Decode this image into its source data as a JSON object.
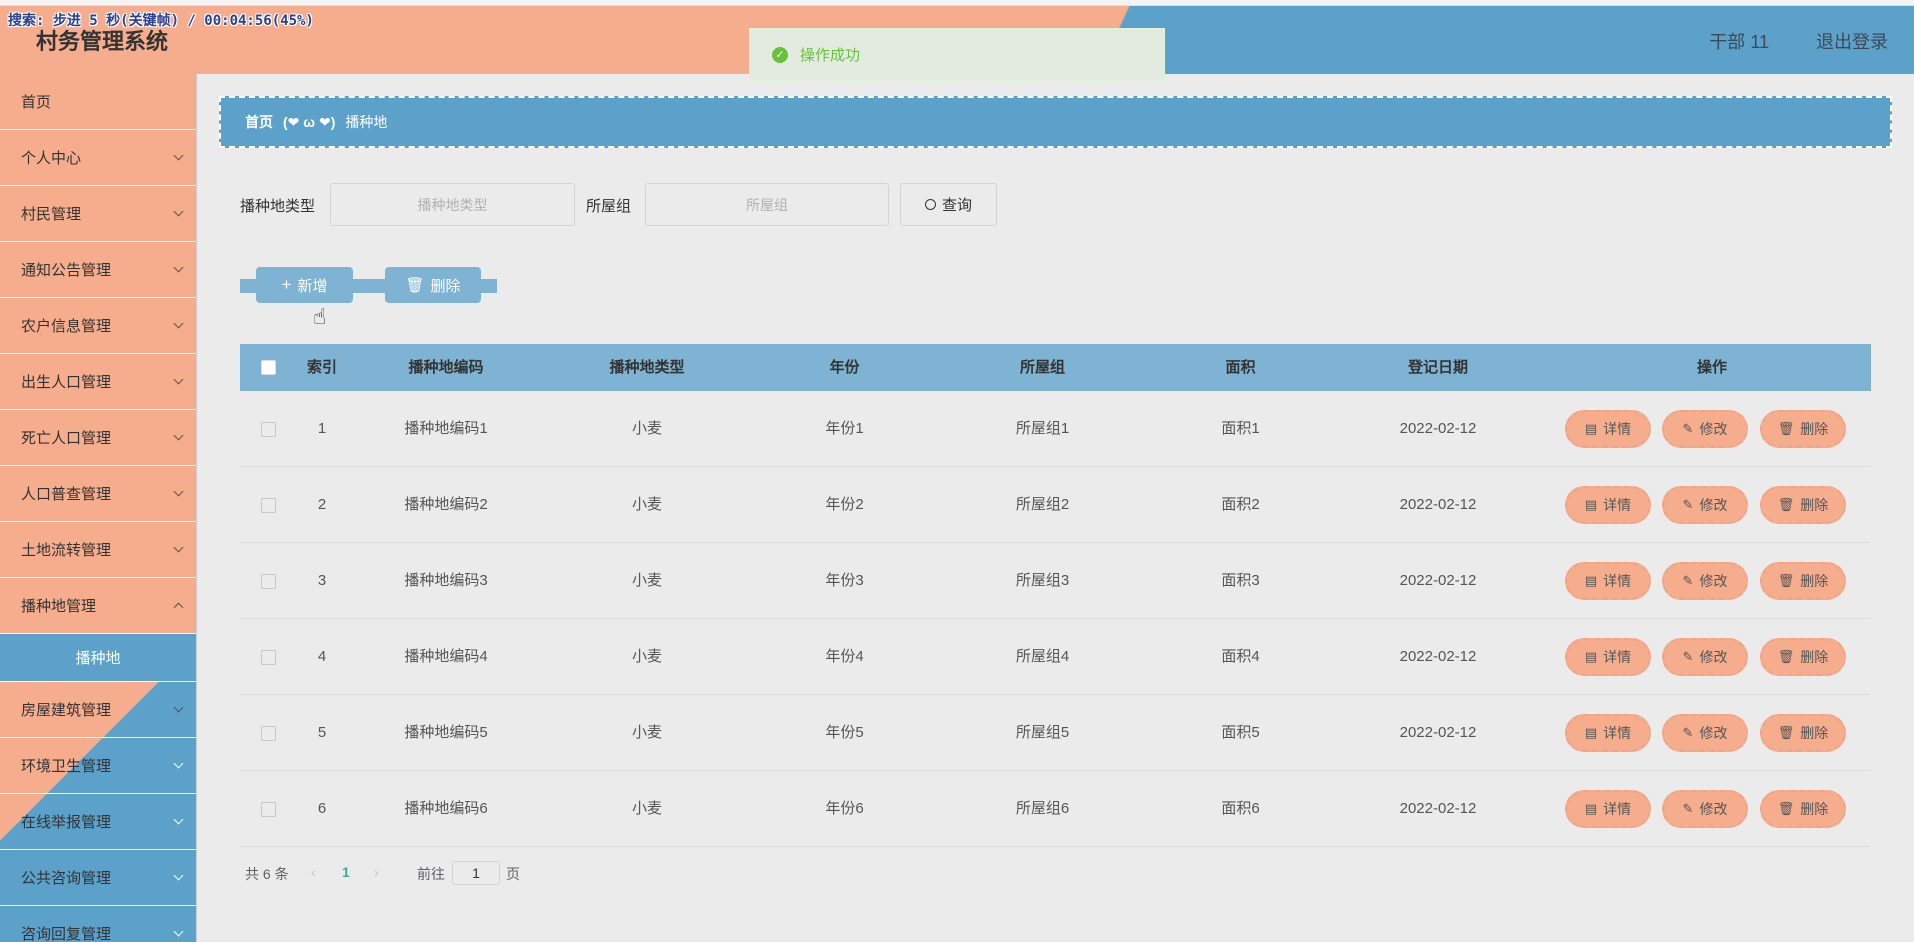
{
  "overlay": "搜索: 步进 5 秒(关键帧) / 00:04:56(45%)",
  "header": {
    "title": "村务管理系统",
    "user": "干部 11",
    "logout": "退出登录"
  },
  "toast": {
    "text": "操作成功"
  },
  "sidebar": {
    "items": [
      {
        "label": "首页"
      },
      {
        "label": "个人中心"
      },
      {
        "label": "村民管理"
      },
      {
        "label": "通知公告管理"
      },
      {
        "label": "农户信息管理"
      },
      {
        "label": "出生人口管理"
      },
      {
        "label": "死亡人口管理"
      },
      {
        "label": "人口普查管理"
      },
      {
        "label": "土地流转管理"
      },
      {
        "label": "播种地管理"
      },
      {
        "label": "播种地"
      },
      {
        "label": "房屋建筑管理"
      },
      {
        "label": "环境卫生管理"
      },
      {
        "label": "在线举报管理"
      },
      {
        "label": "公共咨询管理"
      },
      {
        "label": "咨询回复管理"
      }
    ]
  },
  "breadcrumb": {
    "home": "首页",
    "sep": "(❤ ω ❤)",
    "current": "播种地"
  },
  "search": {
    "type_label": "播种地类型",
    "type_placeholder": "播种地类型",
    "group_label": "所屋组",
    "group_placeholder": "所屋组",
    "query": "查询"
  },
  "actions": {
    "add": "新增",
    "delete": "删除"
  },
  "table": {
    "headers": [
      "索引",
      "播种地编码",
      "播种地类型",
      "年份",
      "所屋组",
      "面积",
      "登记日期",
      "操作"
    ],
    "rows": [
      {
        "idx": "1",
        "code": "播种地编码1",
        "type": "小麦",
        "year": "年份1",
        "group": "所屋组1",
        "area": "面积1",
        "date": "2022-02-12"
      },
      {
        "idx": "2",
        "code": "播种地编码2",
        "type": "小麦",
        "year": "年份2",
        "group": "所屋组2",
        "area": "面积2",
        "date": "2022-02-12"
      },
      {
        "idx": "3",
        "code": "播种地编码3",
        "type": "小麦",
        "year": "年份3",
        "group": "所屋组3",
        "area": "面积3",
        "date": "2022-02-12"
      },
      {
        "idx": "4",
        "code": "播种地编码4",
        "type": "小麦",
        "year": "年份4",
        "group": "所屋组4",
        "area": "面积4",
        "date": "2022-02-12"
      },
      {
        "idx": "5",
        "code": "播种地编码5",
        "type": "小麦",
        "year": "年份5",
        "group": "所屋组5",
        "area": "面积5",
        "date": "2022-02-12"
      },
      {
        "idx": "6",
        "code": "播种地编码6",
        "type": "小麦",
        "year": "年份6",
        "group": "所屋组6",
        "area": "面积6",
        "date": "2022-02-12"
      }
    ],
    "ops": {
      "detail": "详情",
      "edit": "修改",
      "delete": "删除"
    }
  },
  "pagination": {
    "total": "共 6 条",
    "current": "1",
    "goto": "前往",
    "page_value": "1",
    "page_suffix": "页"
  },
  "colors": {
    "salmon": "#f5ad8d",
    "blue": "#5ba1c9",
    "table_head": "#7fb3d3",
    "success": "#67c23a"
  }
}
